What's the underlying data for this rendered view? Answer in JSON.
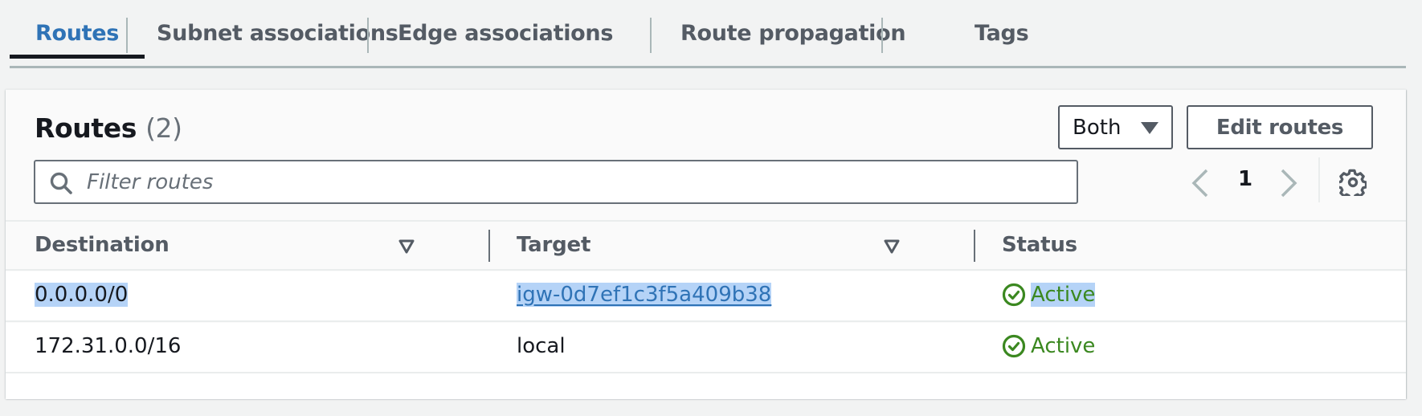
{
  "tabs": [
    {
      "label": "Routes",
      "active": true
    },
    {
      "label": "Subnet associations",
      "active": false
    },
    {
      "label": "Edge associations",
      "active": false
    },
    {
      "label": "Route propagation",
      "active": false
    },
    {
      "label": "Tags",
      "active": false
    }
  ],
  "panel": {
    "title": "Routes",
    "count": "(2)",
    "filter_select": {
      "selected": "Both"
    },
    "edit_button_label": "Edit routes",
    "filter_placeholder": "Filter routes",
    "filter_value": "",
    "pagination": {
      "current_page": "1"
    }
  },
  "table": {
    "columns": [
      "Destination",
      "Target",
      "Status"
    ],
    "rows": [
      {
        "destination": "0.0.0.0/0",
        "target": "igw-0d7ef1c3f5a409b38",
        "target_is_link": true,
        "status": "Active"
      },
      {
        "destination": "172.31.0.0/16",
        "target": "local",
        "target_is_link": false,
        "status": "Active"
      }
    ]
  },
  "colors": {
    "accent_link": "#2f73b6",
    "status_active": "#3b8820",
    "selection_highlight": "#b5d3f7"
  }
}
